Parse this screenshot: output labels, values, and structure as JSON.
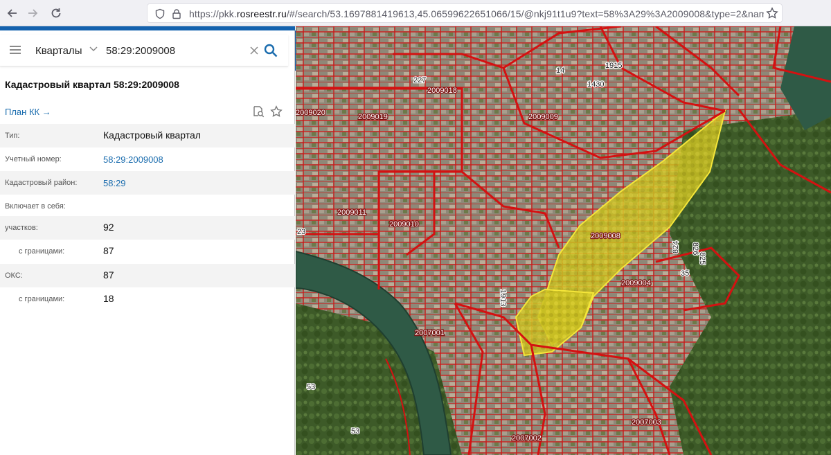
{
  "browser": {
    "url_prefix": "https://pkk.",
    "url_domain": "rosreestr.ru",
    "url_rest": "/#/search/53.1697881419613,45.06599622651066/15/@nkj91t1u9?text=58%3A29%3A2009008&type=2&name"
  },
  "search": {
    "type_label": "Кварталы",
    "query": "58:29:2009008"
  },
  "card": {
    "title": "Кадастровый квартал 58:29:2009008",
    "plan_link": "План КК",
    "rows": [
      {
        "label": "Тип:",
        "value": "Кадастровый квартал"
      },
      {
        "label": "Учетный номер:",
        "value": "58:29:2009008"
      },
      {
        "label": "Кадастровый район:",
        "value": "58:29"
      },
      {
        "label": "Включает в себя:",
        "value": ""
      },
      {
        "label": "участков:",
        "value": "92"
      },
      {
        "label": "с границами:",
        "value": "87"
      },
      {
        "label": "ОКС:",
        "value": "87"
      },
      {
        "label": "с границами:",
        "value": "18"
      }
    ]
  },
  "map": {
    "labels": {
      "q2009018": "2009018",
      "q2009020": "2009020",
      "q2009019": "2009019",
      "q2009009": "2009009",
      "q2009011": "2009011",
      "q2009010": "2009010",
      "q2009008": "2009008",
      "q2009004": "2009004",
      "q2007001": "2007001",
      "q2007003": "2007003",
      "q2007002": "2007002",
      "n227": "227",
      "n14": "14",
      "n1915": "1915",
      "n1430": "1430",
      "n1913": "1913",
      "n23": "23",
      "n53a": "53",
      "n53b": "53",
      "n826": "826",
      "n825": "825",
      "n824": "824",
      "n35": "35"
    },
    "colors": {
      "boundary": "#d41111",
      "highlight": "#e6d21a",
      "river": "#2f5a46",
      "forest": "#3f5e2a",
      "urban": "#9a8f7a"
    }
  }
}
